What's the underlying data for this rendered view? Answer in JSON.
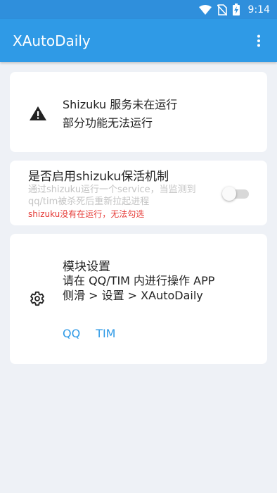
{
  "status_bar": {
    "time": "9:14",
    "icons": [
      "wifi-icon",
      "no-sim-icon",
      "battery-charging-icon"
    ]
  },
  "app_bar": {
    "title": "XAutoDaily",
    "menu_icon": "more-vert-icon"
  },
  "status_card": {
    "icon": "warning-icon",
    "line1": "Shizuku 服务未在运行",
    "line2": "部分功能无法运行"
  },
  "keepalive_card": {
    "title": "是否启用shizuku保活机制",
    "description": "通过shizuku运行一个service，当监测到qq/tim被杀死后重新拉起进程",
    "error": "shizuku没有在运行，无法勾选",
    "switch_on": false
  },
  "module_card": {
    "icon": "settings-gear-icon",
    "title": "模块设置",
    "description": "请在 QQ/TIM 内进行操作 APP 侧滑 > 设置 > XAutoDaily",
    "links": [
      "QQ",
      "TIM"
    ]
  },
  "colors": {
    "app_bar": "#2f9ae6",
    "status_bar": "#2f8fdc",
    "accent": "#2f9ae6",
    "error": "#e53935",
    "background": "#eef1f6"
  }
}
